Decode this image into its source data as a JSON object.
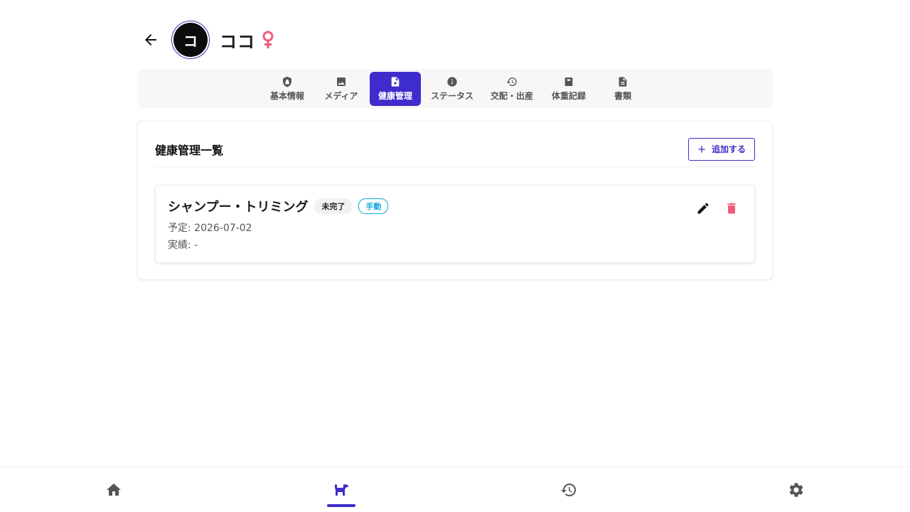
{
  "header": {
    "avatar_initial": "コ",
    "pet_name": "ココ",
    "sex": "female"
  },
  "tabs": [
    {
      "label": "基本情報",
      "icon": "shield-icon"
    },
    {
      "label": "メディア",
      "icon": "image-icon"
    },
    {
      "label": "健康管理",
      "icon": "medical-document-icon",
      "active": true
    },
    {
      "label": "ステータス",
      "icon": "info-icon"
    },
    {
      "label": "交配・出産",
      "icon": "history-icon"
    },
    {
      "label": "体重記録",
      "icon": "scale-icon"
    },
    {
      "label": "書類",
      "icon": "document-icon"
    }
  ],
  "health": {
    "title": "健康管理一覧",
    "add_label": "追加する",
    "items": [
      {
        "title": "シャンプー・トリミング",
        "status": "未完了",
        "source": "手動",
        "scheduled": "予定: 2026-07-02",
        "actual": "実績: -"
      }
    ]
  },
  "bottom_nav": [
    {
      "icon": "home-icon"
    },
    {
      "icon": "dog-icon",
      "active": true
    },
    {
      "icon": "history-icon"
    },
    {
      "icon": "settings-gear-icon"
    }
  ],
  "colors": {
    "accent": "#3f2ccc",
    "female": "#ef5d7a",
    "manual_badge": "#13a8d8",
    "delete": "#ef5d7a"
  }
}
